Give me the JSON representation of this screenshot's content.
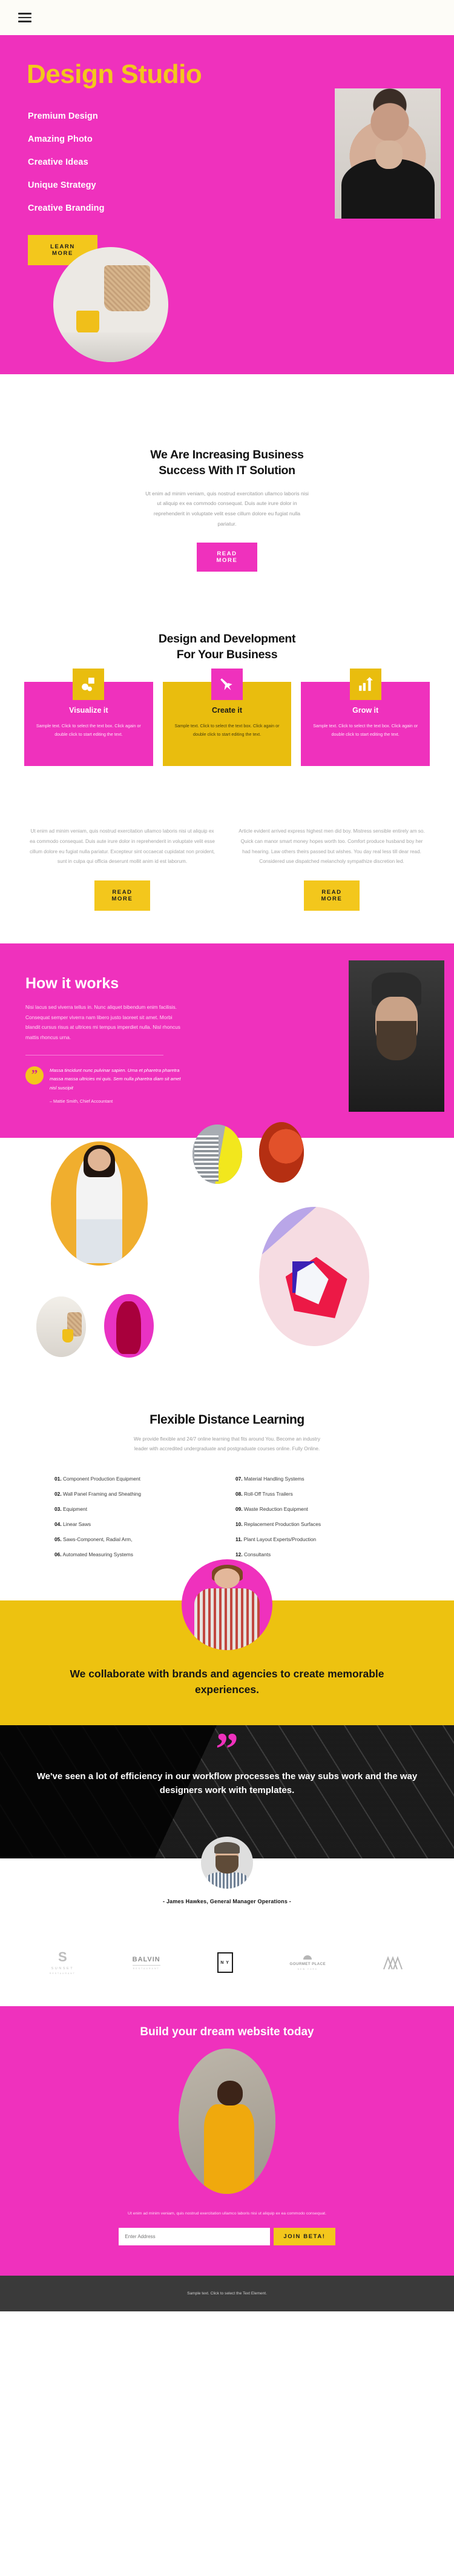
{
  "topbar": {
    "menu_icon": "hamburger-menu-icon"
  },
  "hero": {
    "title": "Design Studio",
    "nav": [
      "Premium Design",
      "Amazing Photo",
      "Creative Ideas",
      "Unique Strategy",
      "Creative Branding"
    ],
    "cta": "LEARN MORE",
    "colors": {
      "background": "#ef31bd",
      "title": "#f3c71c",
      "button": "#f3c71c"
    }
  },
  "intro": {
    "heading_line1": "We Are Increasing Business",
    "heading_line2": "Success With IT Solution",
    "paragraph": "Ut enim ad minim veniam, quis nostrud exercitation ullamco laboris nisi ut aliquip ex ea commodo consequat. Duis aute irure dolor in reprehenderit in voluptate velit esse cillum dolore eu fugiat nulla pariatur.",
    "cta": "READ MORE"
  },
  "services": {
    "heading_line1": "Design and Development",
    "heading_line2": "For Your Business",
    "cards": [
      {
        "title": "Visualize it",
        "text": "Sample text. Click to select the text box. Click again or double click to start editing the text.",
        "icon": "shapes-icon",
        "theme": "pink"
      },
      {
        "title": "Create it",
        "text": "Sample text. Click to select the text box. Click again or double click to start editing the text.",
        "icon": "pen-nib-icon",
        "theme": "yellow"
      },
      {
        "title": "Grow it",
        "text": "Sample text. Click to select the text box. Click again or double click to start editing the text.",
        "icon": "bar-chart-growth-icon",
        "theme": "pink"
      }
    ]
  },
  "twocol": {
    "left": {
      "paragraph": "Ut enim ad minim veniam, quis nostrud exercitation ullamco laboris nisi ut aliquip ex ea commodo consequat. Duis aute irure dolor in reprehenderit in voluptate velit esse cillum dolore eu fugiat nulla pariatur. Excepteur sint occaecat cupidatat non proident, sunt in culpa qui officia deserunt mollit anim id est laborum.",
      "cta": "READ MORE"
    },
    "right": {
      "paragraph": "Article evident arrived express highest men did boy. Mistress sensible entirely am so. Quick can manor smart money hopes worth too. Comfort produce husband boy her had hearing. Law others theirs passed but wishes. You day real less till dear read. Considered use dispatched melancholy sympathize discretion led.",
      "cta": "READ MORE"
    }
  },
  "how": {
    "heading": "How it works",
    "paragraph": "Nisi lacus sed viverra tellus in. Nunc aliquet bibendum enim facilisis. Consequat semper viverra nam libero justo laoreet sit amet. Morbi blandit cursus risus at ultrices mi tempus imperdiet nulla. Nisl rhoncus mattis rhoncus urna.",
    "quote": "Massa tincidunt nunc pulvinar sapien. Urna et pharetra pharetra massa massa ultricies mi quis. Sem nulla pharetra diam sit amet nisl suscipit",
    "quote_author": "– Mattie Smith, Chief Accountant",
    "quote_mark": "”"
  },
  "learning": {
    "heading": "Flexible Distance Learning",
    "paragraph": "We provide flexible and 24/7 online learning that fits around You. Become an industry leader with accredited undergraduate and postgraduate courses online. Fully Online.",
    "left_items": [
      {
        "num": "01.",
        "label": "Component Production Equipment"
      },
      {
        "num": "02.",
        "label": "Wall Panel Framing and Sheathing"
      },
      {
        "num": "03.",
        "label": "Equipment"
      },
      {
        "num": "04.",
        "label": "Linear Saws"
      },
      {
        "num": "05.",
        "label": "Saws-Component, Radial Arm,"
      },
      {
        "num": "06.",
        "label": "Automated Measuring Systems"
      }
    ],
    "right_items": [
      {
        "num": "07.",
        "label": "Material Handling Systems"
      },
      {
        "num": "08.",
        "label": "Roll-Off Truss Trailers"
      },
      {
        "num": "09.",
        "label": "Waste Reduction Equipment"
      },
      {
        "num": "10.",
        "label": "Replacement Production Surfaces"
      },
      {
        "num": "11.",
        "label": "Plant Layout Experts/Production"
      },
      {
        "num": "12.",
        "label": "Consultants"
      }
    ]
  },
  "collaborate": {
    "heading": "We collaborate with brands and agencies to create memorable experiences.",
    "background": "#edc210"
  },
  "testimonial": {
    "quote_mark": "”",
    "quote": "We've seen a lot of efficiency in our workflow processes the way subs work and the way designers work with templates.",
    "author": "- James Hawkes, General Manager Operations -"
  },
  "logos": [
    {
      "name": "sunset-logo",
      "mark": "S",
      "title": "SUNSET",
      "sub": "RESTAURANT"
    },
    {
      "name": "balvin-logo",
      "title": "BALVIN",
      "sub": "RESTAURANT"
    },
    {
      "name": "ny-logo",
      "title": "N Y"
    },
    {
      "name": "gourmet-place-logo",
      "title": "GOURMET PLACE",
      "sub": "NEW YORK"
    },
    {
      "name": "mountain-logo",
      "title": ""
    }
  ],
  "footer_cta": {
    "heading": "Build your dream website today",
    "paragraph": "Ut enim ad minim veniam, quis nostrud exercitation ullamco laboris nisi ut aliquip ex ea commodo consequat.",
    "input_placeholder": "Enter Address",
    "button": "JOIN BETA!"
  },
  "footer": {
    "text": "Sample text. Click to select the Text Element.",
    "background": "#3a3a3a"
  }
}
